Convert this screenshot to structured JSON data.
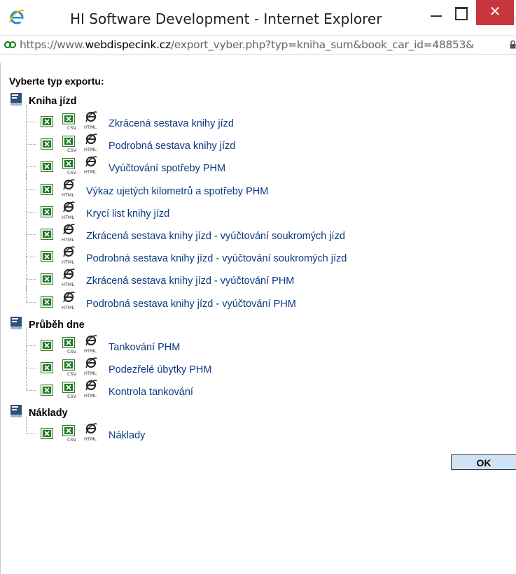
{
  "window": {
    "title": "HI Software Development - Internet Explorer",
    "close_glyph": "✕"
  },
  "address": {
    "url_scheme": "https://www.",
    "url_domain": "webdispecink.cz",
    "url_path": "/export_vyber.php?typ=kniha_sum&book_car_id=48853&"
  },
  "page": {
    "heading": "Vyberte typ exportu:",
    "ok_label": "OK"
  },
  "icons": {
    "excel": "excel-icon",
    "csv": "csv-icon",
    "html": "html-icon",
    "csv_text": "CSV",
    "html_text": "HTML"
  },
  "sections": [
    {
      "title": "Kniha jízd",
      "items": [
        {
          "label": "Zkrácená sestava knihy jízd",
          "csv": true
        },
        {
          "label": "Podrobná sestava knihy jízd",
          "csv": true
        },
        {
          "label": "Vyúčtování spotřeby PHM",
          "csv": true
        },
        {
          "label": "Výkaz ujetých kilometrů a spotřeby PHM",
          "csv": false
        },
        {
          "label": "Krycí list knihy jízd",
          "csv": false
        },
        {
          "label": "Zkrácená sestava knihy jízd - vyúčtování soukromých jízd",
          "csv": false
        },
        {
          "label": "Podrobná sestava knihy jízd - vyúčtování soukromých jízd",
          "csv": false
        },
        {
          "label": "Zkrácená sestava knihy jízd - vyúčtování PHM",
          "csv": false
        },
        {
          "label": "Podrobná sestava knihy jízd - vyúčtování PHM",
          "csv": false
        }
      ]
    },
    {
      "title": "Průběh dne",
      "items": [
        {
          "label": "Tankování PHM",
          "csv": true
        },
        {
          "label": "Podezřelé úbytky PHM",
          "csv": true
        },
        {
          "label": "Kontrola tankování",
          "csv": true
        }
      ]
    },
    {
      "title": "Náklady",
      "items": [
        {
          "label": "Náklady",
          "csv": true
        }
      ]
    }
  ],
  "colors": {
    "link": "#0b3a80",
    "close_button": "#c8373e",
    "ok_button_bg": "#cfe3f5"
  }
}
